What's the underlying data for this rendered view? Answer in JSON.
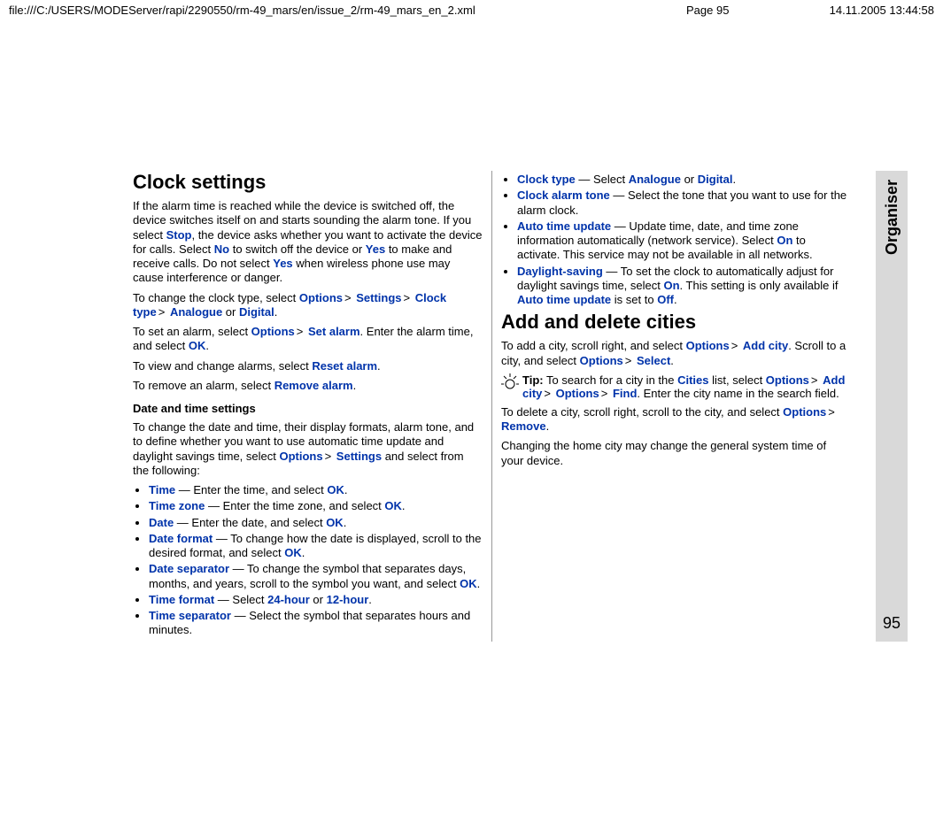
{
  "header": {
    "path": "file:///C:/USERS/MODEServer/rapi/2290550/rm-49_mars/en/issue_2/rm-49_mars_en_2.xml",
    "page": "Page 95",
    "timestamp": "14.11.2005 13:44:58"
  },
  "sidebar": {
    "section": "Organiser",
    "pagenum": "95"
  },
  "left": {
    "h_clock": "Clock settings",
    "p1a": "If the alarm time is reached while the device is switched off, the device switches itself on and starts sounding the alarm tone. If you select ",
    "p1_stop": "Stop",
    "p1b": ", the device asks whether you want to activate the device for calls. Select ",
    "p1_no": "No",
    "p1c": " to switch off the device or ",
    "p1_yes": "Yes",
    "p1d": " to make and receive calls. Do not select ",
    "p1_yes2": "Yes",
    "p1e": " when wireless phone use may cause interference or danger.",
    "p2a": "To change the clock type, select ",
    "p2_options": "Options",
    "p2_settings": "Settings",
    "p2_clocktype": "Clock type",
    "p2_analogue": "Analogue",
    "p2_or": " or ",
    "p2_digital": "Digital",
    "p2_dot": ".",
    "p3a": "To set an alarm, select ",
    "p3_options": "Options",
    "p3_setalarm": "Set alarm",
    "p3b": ". Enter the alarm time, and select ",
    "p3_ok": "OK",
    "p3_dot": ".",
    "p4a": "To view and change alarms, select ",
    "p4_reset": "Reset alarm",
    "p4_dot": ".",
    "p5a": "To remove an alarm, select ",
    "p5_remove": "Remove alarm",
    "p5_dot": ".",
    "h_datetime": "Date and time settings",
    "p6a": "To change the date and time, their display formats, alarm tone, and to define whether you want to use automatic time update and daylight savings time, select ",
    "p6_options": "Options",
    "p6_settings": "Settings",
    "p6b": " and select from the following:",
    "li_time_k": "Time",
    "li_time_t": " — Enter the time, and select ",
    "li_time_ok": "OK",
    "li_tz_k": "Time zone",
    "li_tz_t": " — Enter the time zone, and select ",
    "li_tz_ok": "OK",
    "li_date_k": "Date",
    "li_date_t": " — Enter the date, and select ",
    "li_date_ok": "OK",
    "li_df_k": "Date format",
    "li_df_t": " — To change how the date is displayed, scroll to the desired format, and select ",
    "li_df_ok": "OK",
    "li_ds_k": "Date separator",
    "li_ds_t": " — To change the symbol that separates days, months, and years, scroll to the symbol you want, and select ",
    "li_ds_ok": "OK",
    "li_tf_k": "Time format",
    "li_tf_t": " — Select ",
    "li_tf_24": "24-hour",
    "li_tf_or": " or ",
    "li_tf_12": "12-hour",
    "li_ts_k": "Time separator",
    "li_ts_t": " — Select the symbol that separates hours and minutes.",
    "dot": "."
  },
  "right": {
    "li_ct_k": "Clock type",
    "li_ct_t": " — Select ",
    "li_ct_a": "Analogue",
    "li_ct_or": " or ",
    "li_ct_d": "Digital",
    "li_cat_k": "Clock alarm tone",
    "li_cat_t": " — Select the tone that you want to use for the alarm clock.",
    "li_atu_k": "Auto time update",
    "li_atu_t1": " — Update time, date, and time zone information automatically (network service). Select ",
    "li_atu_on": "On",
    "li_atu_t2": " to activate. This service may not be available in all networks.",
    "li_dl_k": "Daylight-saving",
    "li_dl_t1": " — To set the clock to automatically adjust for daylight savings time, select ",
    "li_dl_on": "On",
    "li_dl_t2": ". This setting is only available if ",
    "li_dl_atu": "Auto time update",
    "li_dl_t3": " is set to ",
    "li_dl_off": "Off",
    "h_cities": "Add and delete cities",
    "p7a": "To add a city, scroll right, and select ",
    "p7_options": "Options",
    "p7_addcity": "Add city",
    "p7b": ". Scroll to a city, and select ",
    "p7_options2": "Options",
    "p7_select": "Select",
    "tip_label": "Tip:",
    "tip_t1": " To search for a city in the ",
    "tip_cities": "Cities",
    "tip_t2": " list, select ",
    "tip_options": "Options",
    "tip_addcity": "Add city",
    "tip_options2": "Options",
    "tip_find": "Find",
    "tip_t3": ". Enter the city name in the search field.",
    "p8a": "To delete a city, scroll right, scroll to the city, and select ",
    "p8_options": "Options",
    "p8_remove": "Remove",
    "p9": "Changing the home city may change the general system time of your device.",
    "dot": ".",
    "gt": ">"
  }
}
